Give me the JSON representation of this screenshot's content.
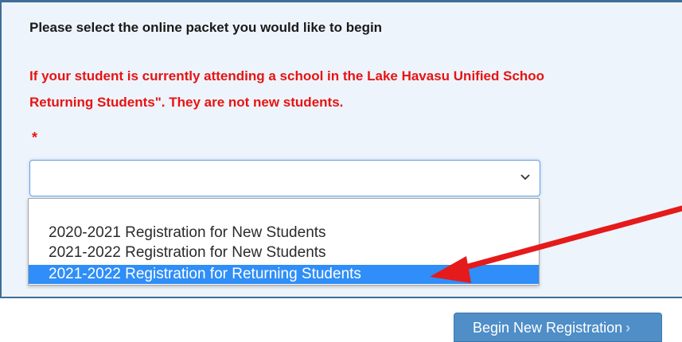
{
  "form": {
    "prompt": "Please select the online packet you would like to begin",
    "warning_line1": "If your student is currently attending a school in the Lake Havasu Unified Schoo",
    "warning_line2": "Returning Students\". They are not new students.",
    "required_marker": "*",
    "packet_select": {
      "selected_value": "",
      "chevron_icon": "chevron-down-icon",
      "options": [
        "2020-2021 Registration for New Students",
        "2021-2022 Registration for New Students",
        "2021-2022 Registration for Returning Students"
      ],
      "highlighted_index": 2
    }
  },
  "actions": {
    "begin_label": "Begin New Registration",
    "begin_icon": "chevron-right-icon"
  },
  "colors": {
    "panel_bg": "#eef4fb",
    "panel_border": "#3f6e98",
    "warning_text": "#e81313",
    "highlight": "#2f8ef8",
    "button": "#4f8ec7",
    "annotation_arrow": "#e51a1a"
  }
}
